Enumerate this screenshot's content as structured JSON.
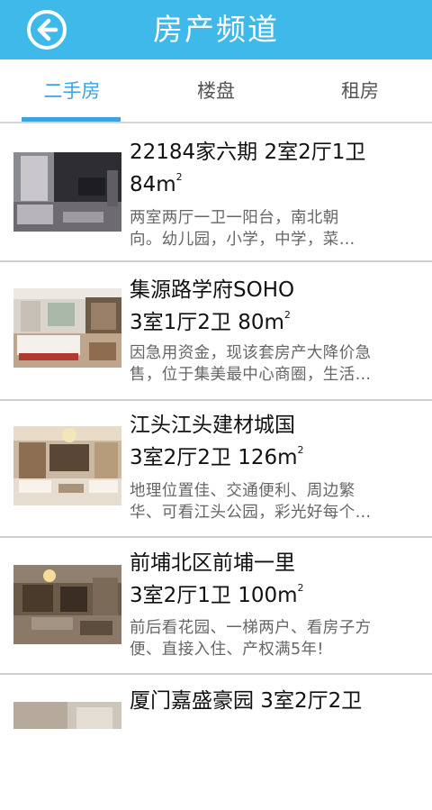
{
  "header": {
    "title": "房产频道",
    "back_icon": "back-arrow-circle-icon",
    "background_color": "#3fb8ea"
  },
  "tabs": [
    {
      "label": "二手房",
      "active": true
    },
    {
      "label": "楼盘",
      "active": false
    },
    {
      "label": "租房",
      "active": false
    }
  ],
  "accent_color": "#3fa2e0",
  "listings": [
    {
      "title_line1": "22184家六期 2室2厅1卫",
      "title_line2": "84m",
      "superscript": "2",
      "description_line1": "两室两厅一卫一阳台，南北朝",
      "description_line2": "向。幼儿园，小学，中学，菜…",
      "image": "living-room-photo"
    },
    {
      "title_line1": "集源路学府SOHO",
      "title_line2": "3室1厅2卫 80m",
      "superscript": "2",
      "description_line1": "因急用资金，现该套房产大降价急",
      "description_line2": "售，位于集美最中心商圈，生活…",
      "image": "bedroom-photo"
    },
    {
      "title_line1": "江头江头建材城国",
      "title_line2": "3室2厅2卫 126m",
      "superscript": "2",
      "description_line1": "地理位置佳、交通便利、周边繁",
      "description_line2": "华、可看江头公园，彩光好每个…",
      "image": "decorated-living-room-photo"
    },
    {
      "title_line1": "前埔北区前埔一里",
      "title_line2": "3室2厅1卫 100m",
      "superscript": "2",
      "description_line1": "前后看花园、一梯两户、看房子方",
      "description_line2": "便、直接入住、产权满5年!",
      "image": "dining-room-photo"
    },
    {
      "title_line1": "厦门嘉盛豪园 3室2厅2卫",
      "title_line2": "",
      "superscript": "",
      "description_line1": "",
      "description_line2": "",
      "image": "room-photo"
    }
  ]
}
